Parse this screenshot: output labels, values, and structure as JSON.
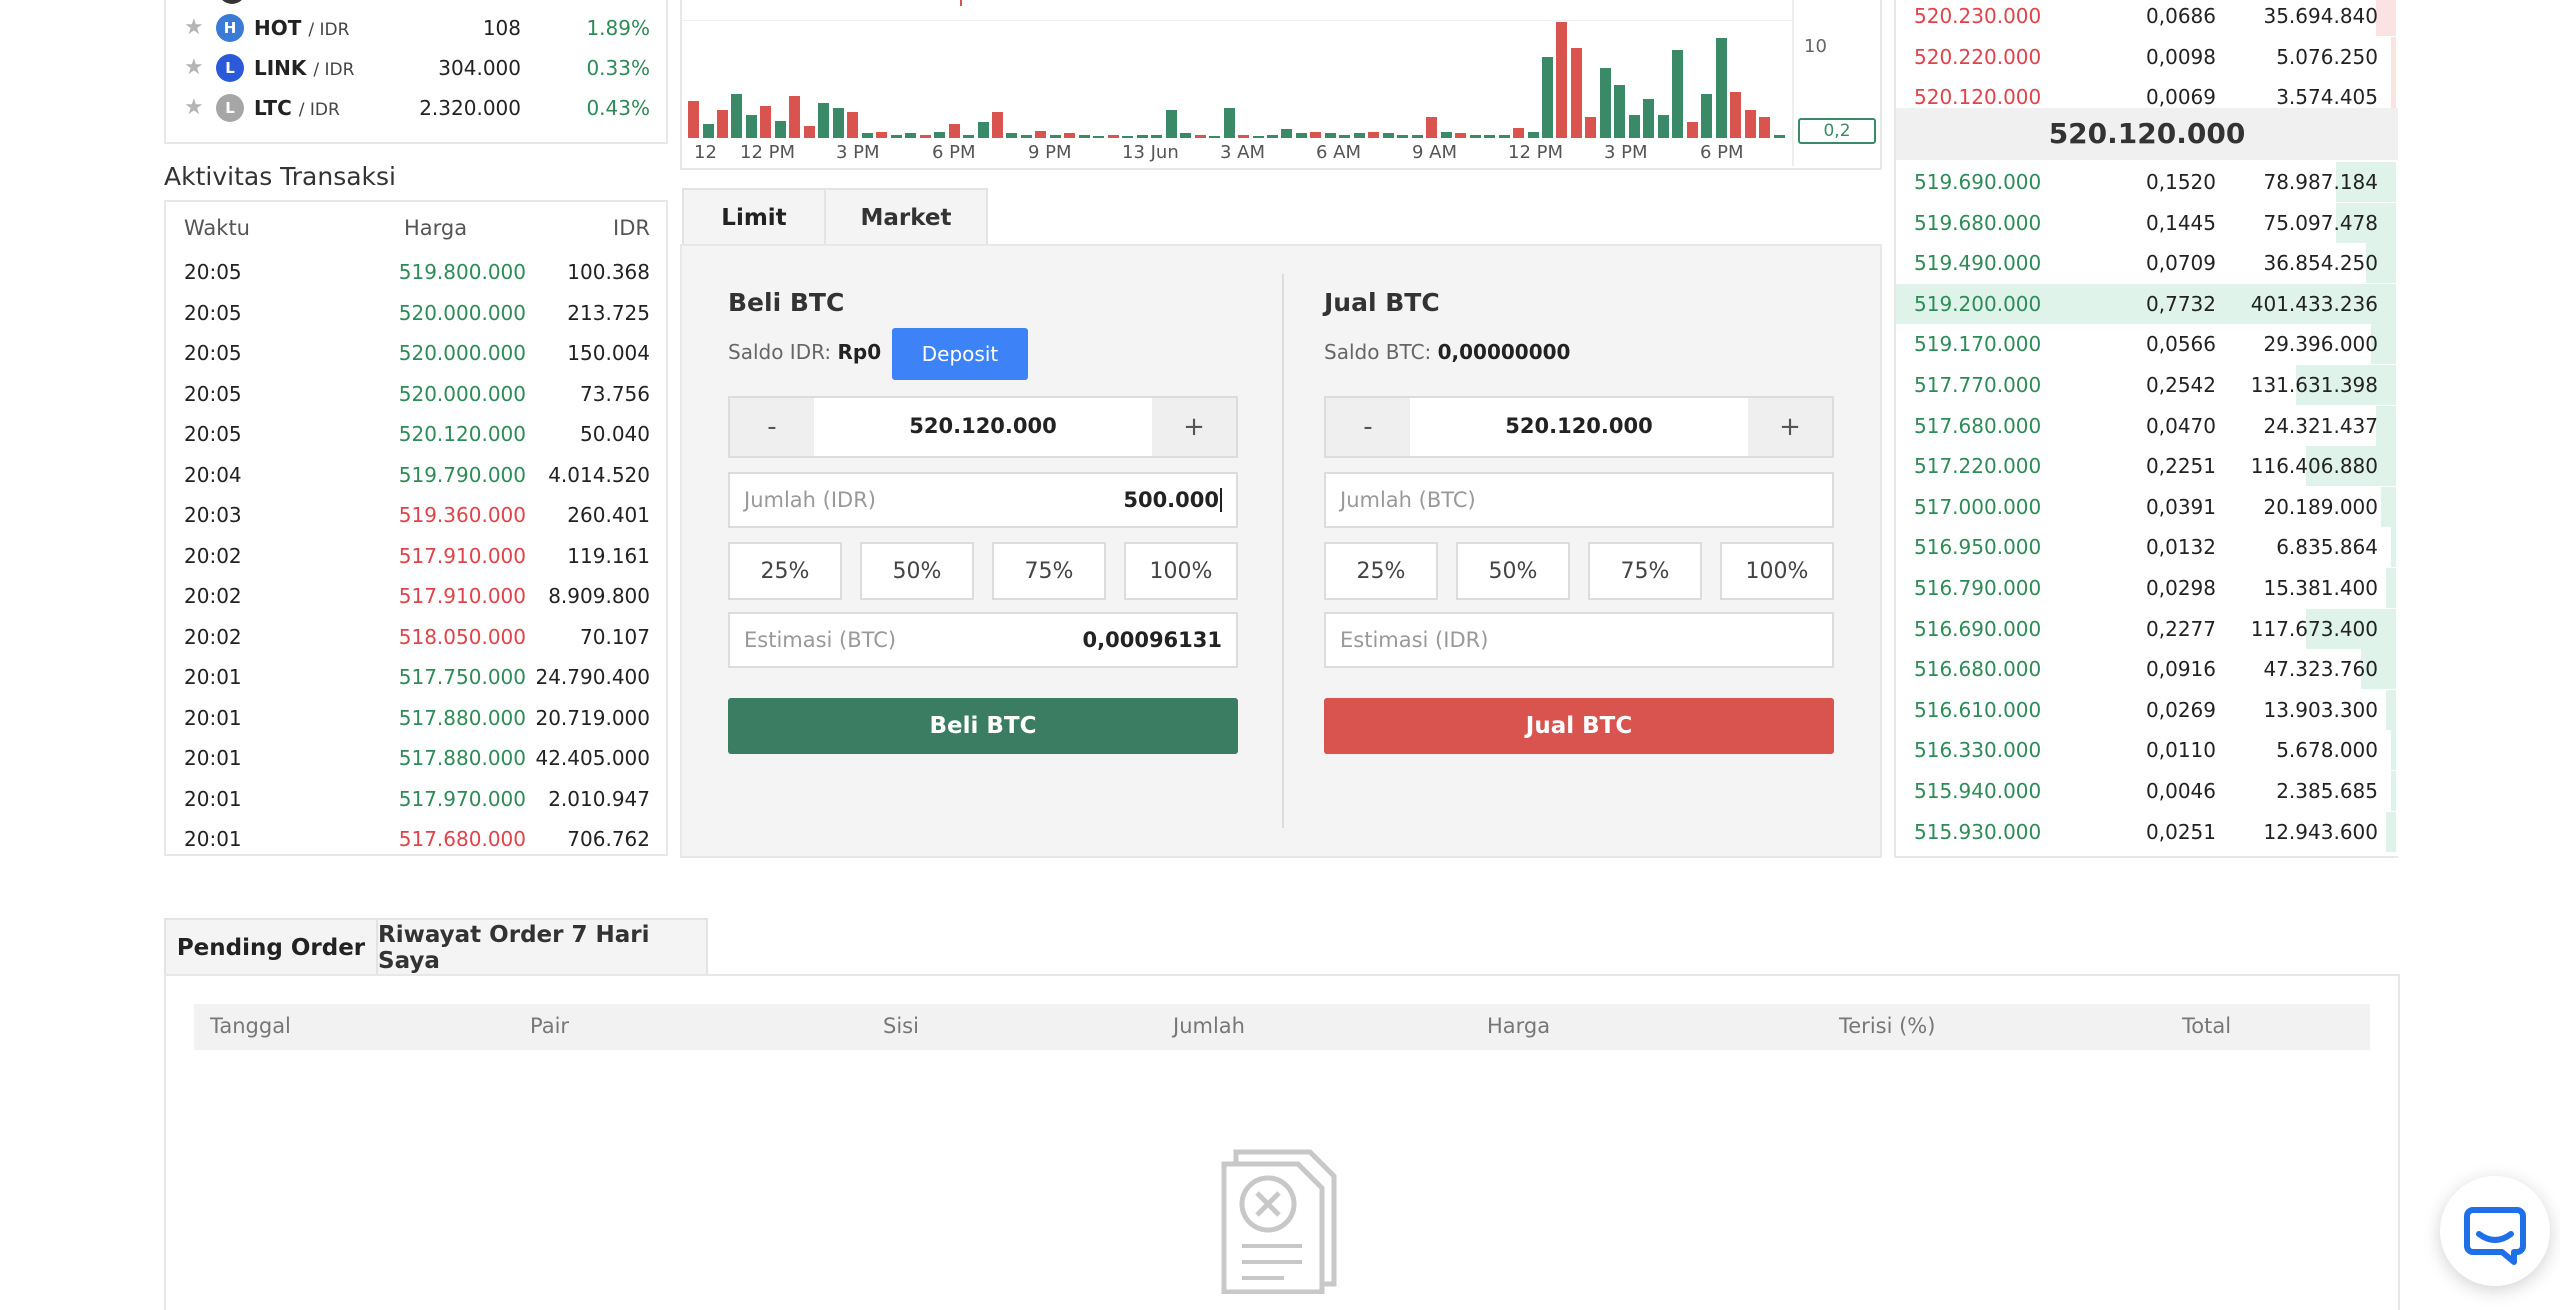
{
  "markets": [
    {
      "symbol": "HOT",
      "quote": "/ IDR",
      "price": "108",
      "change": "1.89%",
      "color": "#3a7bd5",
      "icon": "hot-coin-icon"
    },
    {
      "symbol": "LINK",
      "quote": "/ IDR",
      "price": "304.000",
      "change": "0.33%",
      "color": "#2a5ada",
      "icon": "link-coin-icon"
    },
    {
      "symbol": "LTC",
      "quote": "/ IDR",
      "price": "2.320.000",
      "change": "0.43%",
      "color": "#a6a6a6",
      "icon": "ltc-coin-icon"
    }
  ],
  "activity": {
    "title": "Aktivitas Transaksi",
    "headers": {
      "time": "Waktu",
      "price": "Harga",
      "amount": "IDR"
    },
    "rows": [
      {
        "time": "20:05",
        "price": "519.800.000",
        "amount": "100.368",
        "side": "buy"
      },
      {
        "time": "20:05",
        "price": "520.000.000",
        "amount": "213.725",
        "side": "buy"
      },
      {
        "time": "20:05",
        "price": "520.000.000",
        "amount": "150.004",
        "side": "buy"
      },
      {
        "time": "20:05",
        "price": "520.000.000",
        "amount": "73.756",
        "side": "buy"
      },
      {
        "time": "20:05",
        "price": "520.120.000",
        "amount": "50.040",
        "side": "buy"
      },
      {
        "time": "20:04",
        "price": "519.790.000",
        "amount": "4.014.520",
        "side": "buy"
      },
      {
        "time": "20:03",
        "price": "519.360.000",
        "amount": "260.401",
        "side": "sell"
      },
      {
        "time": "20:02",
        "price": "517.910.000",
        "amount": "119.161",
        "side": "sell"
      },
      {
        "time": "20:02",
        "price": "517.910.000",
        "amount": "8.909.800",
        "side": "sell"
      },
      {
        "time": "20:02",
        "price": "518.050.000",
        "amount": "70.107",
        "side": "sell"
      },
      {
        "time": "20:01",
        "price": "517.750.000",
        "amount": "24.790.400",
        "side": "buy"
      },
      {
        "time": "20:01",
        "price": "517.880.000",
        "amount": "20.719.000",
        "side": "buy"
      },
      {
        "time": "20:01",
        "price": "517.880.000",
        "amount": "42.405.000",
        "side": "buy"
      },
      {
        "time": "20:01",
        "price": "517.970.000",
        "amount": "2.010.947",
        "side": "buy"
      },
      {
        "time": "20:01",
        "price": "517.680.000",
        "amount": "706.762",
        "side": "sell"
      }
    ]
  },
  "chart": {
    "x_ticks": [
      "12",
      "12 PM",
      "3 PM",
      "6 PM",
      "9 PM",
      "13 Jun",
      "3 AM",
      "6 AM",
      "9 AM",
      "12 PM",
      "3 PM",
      "6 PM"
    ],
    "y_tick": "10",
    "last_volume": "0,2",
    "colors": {
      "up": "#3a8a68",
      "down": "#d9534f"
    },
    "volumes": [
      {
        "v": 3.2,
        "d": "down"
      },
      {
        "v": 1.2,
        "d": "up"
      },
      {
        "v": 2.4,
        "d": "down"
      },
      {
        "v": 3.8,
        "d": "up"
      },
      {
        "v": 2.0,
        "d": "up"
      },
      {
        "v": 2.8,
        "d": "down"
      },
      {
        "v": 1.5,
        "d": "up"
      },
      {
        "v": 3.6,
        "d": "down"
      },
      {
        "v": 1.0,
        "d": "down"
      },
      {
        "v": 3.0,
        "d": "up"
      },
      {
        "v": 2.6,
        "d": "up"
      },
      {
        "v": 2.2,
        "d": "down"
      },
      {
        "v": 0.4,
        "d": "up"
      },
      {
        "v": 0.5,
        "d": "down"
      },
      {
        "v": 0.3,
        "d": "up"
      },
      {
        "v": 0.4,
        "d": "up"
      },
      {
        "v": 0.3,
        "d": "down"
      },
      {
        "v": 0.5,
        "d": "up"
      },
      {
        "v": 1.2,
        "d": "down"
      },
      {
        "v": 0.3,
        "d": "up"
      },
      {
        "v": 1.4,
        "d": "up"
      },
      {
        "v": 2.2,
        "d": "down"
      },
      {
        "v": 0.4,
        "d": "up"
      },
      {
        "v": 0.3,
        "d": "up"
      },
      {
        "v": 0.6,
        "d": "down"
      },
      {
        "v": 0.3,
        "d": "up"
      },
      {
        "v": 0.4,
        "d": "down"
      },
      {
        "v": 0.3,
        "d": "up"
      },
      {
        "v": 0.2,
        "d": "up"
      },
      {
        "v": 0.3,
        "d": "down"
      },
      {
        "v": 0.2,
        "d": "up"
      },
      {
        "v": 0.3,
        "d": "up"
      },
      {
        "v": 0.3,
        "d": "up"
      },
      {
        "v": 2.4,
        "d": "up"
      },
      {
        "v": 0.4,
        "d": "up"
      },
      {
        "v": 0.3,
        "d": "down"
      },
      {
        "v": 0.2,
        "d": "up"
      },
      {
        "v": 2.6,
        "d": "up"
      },
      {
        "v": 0.3,
        "d": "down"
      },
      {
        "v": 0.2,
        "d": "up"
      },
      {
        "v": 0.3,
        "d": "up"
      },
      {
        "v": 0.8,
        "d": "up"
      },
      {
        "v": 0.4,
        "d": "up"
      },
      {
        "v": 0.5,
        "d": "down"
      },
      {
        "v": 0.4,
        "d": "up"
      },
      {
        "v": 0.3,
        "d": "up"
      },
      {
        "v": 0.4,
        "d": "up"
      },
      {
        "v": 0.5,
        "d": "down"
      },
      {
        "v": 0.4,
        "d": "up"
      },
      {
        "v": 0.3,
        "d": "up"
      },
      {
        "v": 0.3,
        "d": "up"
      },
      {
        "v": 1.8,
        "d": "down"
      },
      {
        "v": 0.5,
        "d": "up"
      },
      {
        "v": 0.4,
        "d": "down"
      },
      {
        "v": 0.3,
        "d": "up"
      },
      {
        "v": 0.3,
        "d": "up"
      },
      {
        "v": 0.3,
        "d": "up"
      },
      {
        "v": 0.9,
        "d": "down"
      },
      {
        "v": 0.5,
        "d": "up"
      },
      {
        "v": 7.0,
        "d": "up"
      },
      {
        "v": 10.0,
        "d": "down"
      },
      {
        "v": 7.8,
        "d": "down"
      },
      {
        "v": 1.8,
        "d": "down"
      },
      {
        "v": 6.0,
        "d": "up"
      },
      {
        "v": 4.6,
        "d": "up"
      },
      {
        "v": 2.0,
        "d": "up"
      },
      {
        "v": 3.4,
        "d": "up"
      },
      {
        "v": 2.0,
        "d": "up"
      },
      {
        "v": 7.6,
        "d": "up"
      },
      {
        "v": 1.4,
        "d": "down"
      },
      {
        "v": 3.8,
        "d": "up"
      },
      {
        "v": 8.6,
        "d": "up"
      },
      {
        "v": 4.0,
        "d": "down"
      },
      {
        "v": 2.4,
        "d": "down"
      },
      {
        "v": 1.8,
        "d": "down"
      },
      {
        "v": 0.3,
        "d": "up"
      }
    ]
  },
  "form": {
    "tabs": [
      "Limit",
      "Market"
    ],
    "buy": {
      "title": "Beli BTC",
      "balance_label": "Saldo IDR:",
      "balance_value": "Rp0",
      "deposit": "Deposit",
      "price": "520.120.000",
      "amount_placeholder": "Jumlah (IDR)",
      "amount_value": "500.000",
      "estimate_placeholder": "Estimasi (BTC)",
      "estimate_value": "0,00096131",
      "submit": "Beli BTC"
    },
    "sell": {
      "title": "Jual BTC",
      "balance_label": "Saldo BTC:",
      "balance_value": "0,00000000",
      "price": "520.120.000",
      "amount_placeholder": "Jumlah (BTC)",
      "estimate_placeholder": "Estimasi (IDR)",
      "submit": "Jual BTC"
    },
    "percentages": [
      "25%",
      "50%",
      "75%",
      "100%"
    ],
    "minus": "-",
    "plus": "+",
    "colors": {
      "buy": "#3a7d63",
      "sell": "#d9534f",
      "deposit": "#3d82f6"
    }
  },
  "orderbook": {
    "asks": [
      {
        "price": "520.230.000",
        "amount": "0,0686",
        "total": "35.694.840",
        "depth": 0.04
      },
      {
        "price": "520.220.000",
        "amount": "0,0098",
        "total": "5.076.250",
        "depth": 0.01
      },
      {
        "price": "520.120.000",
        "amount": "0,0069",
        "total": "3.574.405",
        "depth": 0.01
      }
    ],
    "last_price": "520.120.000",
    "bids": [
      {
        "price": "519.690.000",
        "amount": "0,1520",
        "total": "78.987.184",
        "depth": 0.12
      },
      {
        "price": "519.680.000",
        "amount": "0,1445",
        "total": "75.097.478",
        "depth": 0.12
      },
      {
        "price": "519.490.000",
        "amount": "0,0709",
        "total": "36.854.250",
        "depth": 0.06
      },
      {
        "price": "519.200.000",
        "amount": "0,7732",
        "total": "401.433.236",
        "depth": 1.0
      },
      {
        "price": "519.170.000",
        "amount": "0,0566",
        "total": "29.396.000",
        "depth": 0.05
      },
      {
        "price": "517.770.000",
        "amount": "0,2542",
        "total": "131.631.398",
        "depth": 0.2
      },
      {
        "price": "517.680.000",
        "amount": "0,0470",
        "total": "24.321.437",
        "depth": 0.04
      },
      {
        "price": "517.220.000",
        "amount": "0,2251",
        "total": "116.406.880",
        "depth": 0.18
      },
      {
        "price": "517.000.000",
        "amount": "0,0391",
        "total": "20.189.000",
        "depth": 0.03
      },
      {
        "price": "516.950.000",
        "amount": "0,0132",
        "total": "6.835.864",
        "depth": 0.01
      },
      {
        "price": "516.790.000",
        "amount": "0,0298",
        "total": "15.381.400",
        "depth": 0.02
      },
      {
        "price": "516.690.000",
        "amount": "0,2277",
        "total": "117.673.400",
        "depth": 0.18
      },
      {
        "price": "516.680.000",
        "amount": "0,0916",
        "total": "47.323.760",
        "depth": 0.07
      },
      {
        "price": "516.610.000",
        "amount": "0,0269",
        "total": "13.903.300",
        "depth": 0.02
      },
      {
        "price": "516.330.000",
        "amount": "0,0110",
        "total": "5.678.000",
        "depth": 0.01
      },
      {
        "price": "515.940.000",
        "amount": "0,0046",
        "total": "2.385.685",
        "depth": 0.01
      },
      {
        "price": "515.930.000",
        "amount": "0,0251",
        "total": "12.943.600",
        "depth": 0.02
      }
    ]
  },
  "orders": {
    "tabs": [
      "Pending Order",
      "Riwayat Order 7 Hari Saya"
    ],
    "headers": [
      "Tanggal",
      "Pair",
      "Sisi",
      "Jumlah",
      "Harga",
      "Terisi (%)",
      "Total"
    ],
    "empty_icon": "empty-document-icon"
  },
  "chat": {
    "icon": "chat-bubble-icon",
    "color": "#1e6fe8"
  }
}
